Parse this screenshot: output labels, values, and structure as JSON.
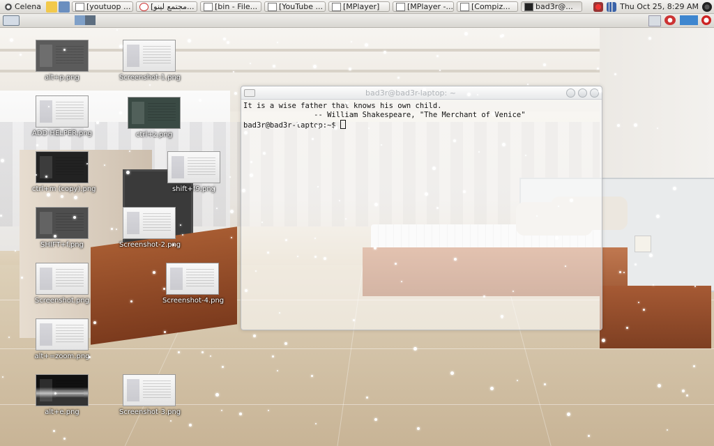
{
  "top_panel": {
    "menu_label": "Celena",
    "tasks": [
      {
        "label": "[youtuop ..."
      },
      {
        "label": "[مجتمع لينو..."
      },
      {
        "label": "[bin - File..."
      },
      {
        "label": "[YouTube ..."
      },
      {
        "label": "[MPlayer]"
      },
      {
        "label": "[MPlayer -..."
      },
      {
        "label": "[Compiz..."
      },
      {
        "label": "bad3r@..."
      }
    ],
    "clock": "Thu Oct 25,  8:29 AM"
  },
  "desktop_icons": [
    {
      "label": "alt+p.png"
    },
    {
      "label": "Screenshot-1.png"
    },
    {
      "label": "ADD HELPER.png"
    },
    {
      "label": "ctrl+z.png"
    },
    {
      "label": "ctrl+m (copy).png"
    },
    {
      "label": "shift+f9.png"
    },
    {
      "label": "SHIFT+f.png"
    },
    {
      "label": "Screenshot-2.png"
    },
    {
      "label": "Screenshot.png"
    },
    {
      "label": "Screenshot-4.png"
    },
    {
      "label": "alt+=zoom.png"
    },
    {
      "label": "alt+e.png"
    },
    {
      "label": "Screenshot-3.png"
    }
  ],
  "terminal": {
    "title": "bad3r@bad3r-laptop: ~",
    "line1": "It is a wise father that knows his own child.",
    "line2": "                -- William Shakespeare, \"The Merchant of Venice\"",
    "prompt": "bad3r@bad3r-laptop:~$ "
  },
  "colors": {
    "panel_bg": "#e6e4e0",
    "terminal_border": "#b9bcc0",
    "cabinet": "#a75c32"
  }
}
